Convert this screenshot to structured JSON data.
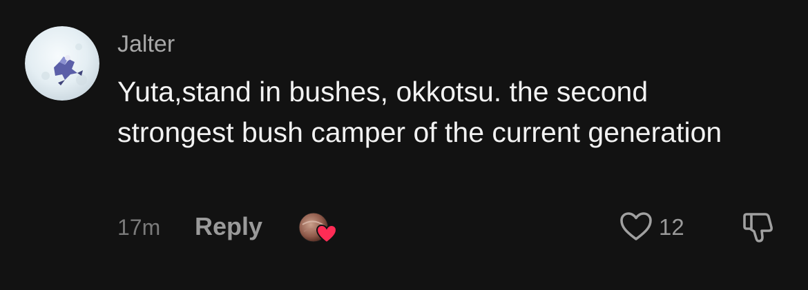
{
  "comment": {
    "username": "Jalter",
    "text": "Yuta,stand in bushes, okkotsu. the second strongest bush camper of the current generation",
    "timestamp": "17m",
    "reply_label": "Reply",
    "like_count": "12",
    "liked_by_creator": true
  },
  "icons": {
    "like": "heart-outline-icon",
    "dislike": "thumbs-down-icon",
    "creator_like": "heart-filled-icon"
  },
  "colors": {
    "background": "#121212",
    "text_primary": "#f2f2f2",
    "text_secondary": "#9a9a9a",
    "heart_badge": "#fe2c55"
  }
}
